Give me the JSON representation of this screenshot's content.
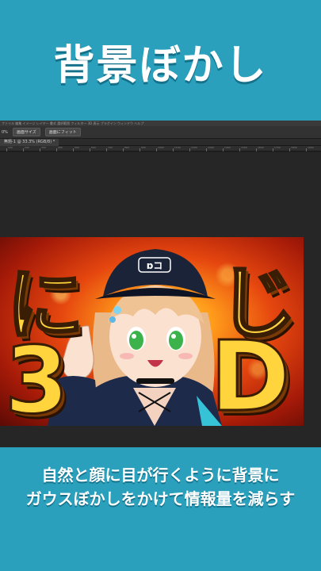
{
  "title": "背景ぼかし",
  "photoshop": {
    "menubar_text": "ファイル  編集  イメージ  レイヤー  書式  選択範囲  フィルター  3D  表示  プラグイン  ウィンドウ  ヘルプ",
    "zoom_label": "0%",
    "options_buttons": [
      "画面サイズ",
      "画面にフィット"
    ],
    "document_tab": "無題-1 @ 33.3% (RGB/8) *",
    "ruler_numbers": [
      "100",
      "200",
      "300",
      "400",
      "500",
      "600",
      "700",
      "800",
      "900",
      "1000",
      "1100",
      "1200",
      "1300",
      "1400",
      "1500",
      "1600",
      "1700",
      "1800",
      "1900"
    ]
  },
  "artwork": {
    "letters": [
      "に",
      "3",
      "じ",
      "D"
    ],
    "cap_logo": "ɒコ"
  },
  "caption": {
    "line1": "自然と顔に目が行くように背景に",
    "line2": "ガウスぼかしをかけて情報量を減らす"
  },
  "colors": {
    "band": "#2aa0bd",
    "ps_bg": "#1f1f1f",
    "letter_fill": "#ffd43c"
  }
}
